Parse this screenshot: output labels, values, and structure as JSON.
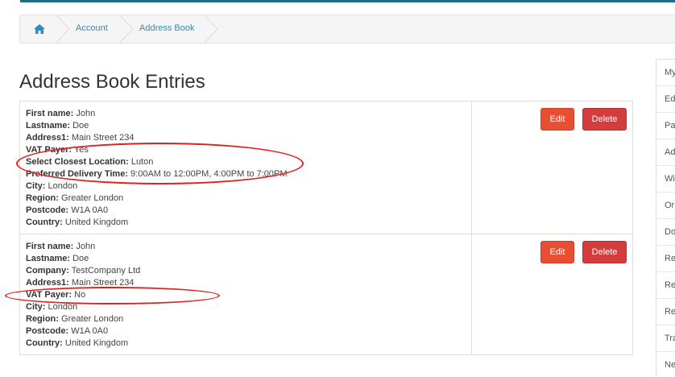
{
  "breadcrumb": {
    "home_icon": "home-icon",
    "items": [
      "Account",
      "Address Book"
    ]
  },
  "page_title": "Address Book Entries",
  "entries": [
    {
      "fields": [
        {
          "label": "First name:",
          "value": " John"
        },
        {
          "label": "Lastname:",
          "value": " Doe"
        },
        {
          "label": "Address1:",
          "value": " Main Street 234"
        },
        {
          "label": "VAT Payer:",
          "value": " Yes"
        },
        {
          "label": "Select Closest Location:",
          "value": " Luton"
        },
        {
          "label": "Preferred Delivery Time:",
          "value": " 9:00AM to 12:00PM, 4:00PM to 7:00PM"
        },
        {
          "label": "City:",
          "value": " London"
        },
        {
          "label": "Region:",
          "value": " Greater London"
        },
        {
          "label": "Postcode:",
          "value": " W1A 0A0"
        },
        {
          "label": "Country:",
          "value": " United Kingdom"
        }
      ],
      "edit_label": "Edit",
      "delete_label": "Delete"
    },
    {
      "fields": [
        {
          "label": "First name:",
          "value": " John"
        },
        {
          "label": "Lastname:",
          "value": " Doe"
        },
        {
          "label": "Company:",
          "value": " TestCompany Ltd"
        },
        {
          "label": "Address1:",
          "value": " Main Street 234"
        },
        {
          "label": "VAT Payer:",
          "value": " No"
        },
        {
          "label": "City:",
          "value": " London"
        },
        {
          "label": "Region:",
          "value": " Greater London"
        },
        {
          "label": "Postcode:",
          "value": " W1A 0A0"
        },
        {
          "label": "Country:",
          "value": " United Kingdom"
        }
      ],
      "edit_label": "Edit",
      "delete_label": "Delete"
    }
  ],
  "side_menu": [
    "My",
    "Ed",
    "Pa",
    "Ad",
    "Wi",
    "Or",
    "Do",
    "Re",
    "Re",
    "Re",
    "Tra",
    "Ne"
  ],
  "colors": {
    "edit_button": "#e84e31",
    "delete_button": "#d43d3d",
    "link": "#2e8cc2",
    "annotation": "#e02020"
  }
}
